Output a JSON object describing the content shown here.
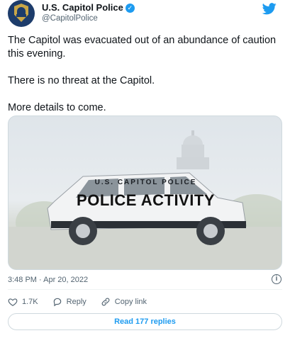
{
  "author": {
    "display_name": "U.S. Capitol Police",
    "handle": "@CapitolPolice",
    "verified_icon": "verified-badge-icon"
  },
  "tweet": {
    "paragraphs": [
      "The Capitol was evacuated out of an abundance of caution this evening.",
      "There is no threat at the Capitol.",
      "More details to come."
    ],
    "timestamp": "3:48 PM · Apr 20, 2022"
  },
  "media": {
    "small_label": "U.S. CAPITOL POLICE",
    "big_label": "POLICE ACTIVITY"
  },
  "actions": {
    "likes": "1.7K",
    "reply_label": "Reply",
    "copy_label": "Copy link"
  },
  "replies_button": "Read 177 replies",
  "colors": {
    "accent": "#1d9bf0",
    "secondary_text": "#536471",
    "border": "#cfd9de"
  }
}
